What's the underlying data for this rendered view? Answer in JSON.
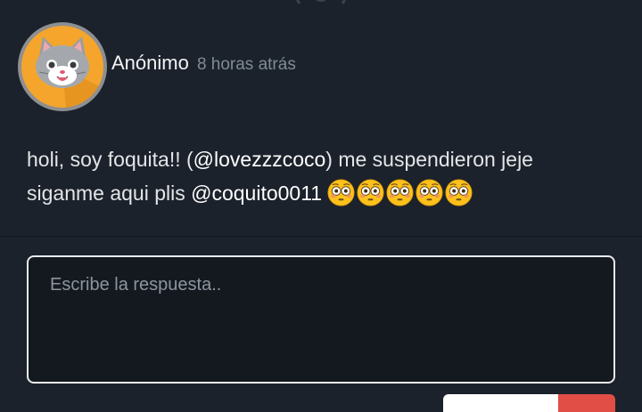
{
  "post": {
    "author": "Anónimo",
    "timestamp": "8 horas atrás",
    "message": {
      "text_before": "holi, soy foquita!! (",
      "mention_1": "@lovezzzcoco",
      "text_middle": ") me suspendieron jeje siganme aqui plis ",
      "mention_2": "@coquito0011",
      "emoji_count": 5,
      "emoji_name": "flushed-face"
    }
  },
  "reply": {
    "placeholder": "Escribe la respuesta.."
  },
  "colors": {
    "background": "#1c222b",
    "reply_bg": "#141920",
    "accent_red": "#e04e46",
    "avatar_bg": "#f5a52c"
  }
}
